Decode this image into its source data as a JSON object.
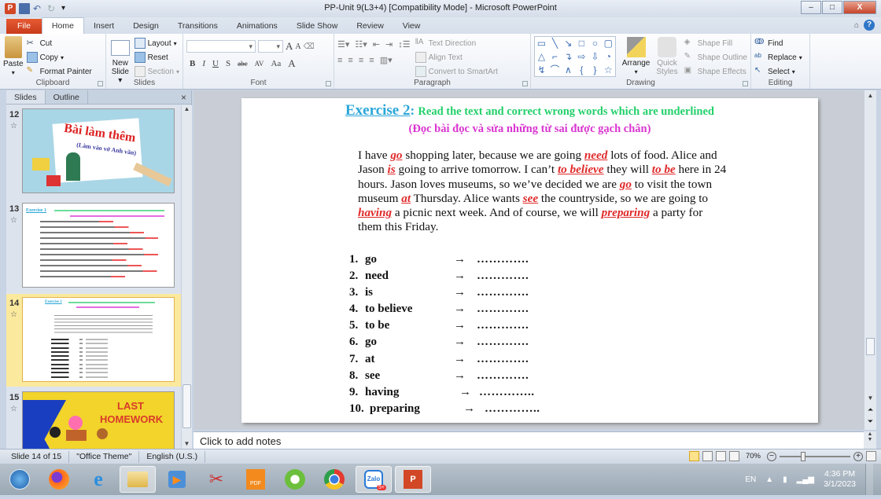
{
  "window": {
    "title": "PP-Unit 9(L3+4) [Compatibility Mode] - Microsoft PowerPoint",
    "controls": {
      "minimize": "–",
      "maximize": "□",
      "close": "X"
    }
  },
  "quick_access": {
    "app_icon": "P",
    "save": "save-icon",
    "undo": "undo-icon",
    "redo": "redo-icon",
    "customize": "▾"
  },
  "tabs": [
    {
      "label": "File"
    },
    {
      "label": "Home",
      "active": true
    },
    {
      "label": "Insert"
    },
    {
      "label": "Design"
    },
    {
      "label": "Transitions"
    },
    {
      "label": "Animations"
    },
    {
      "label": "Slide Show"
    },
    {
      "label": "Review"
    },
    {
      "label": "View"
    }
  ],
  "ribbon": {
    "clipboard": {
      "label": "Clipboard",
      "paste": "Paste",
      "cut": "Cut",
      "copy": "Copy",
      "format_painter": "Format Painter"
    },
    "slides": {
      "label": "Slides",
      "new_slide_1": "New",
      "new_slide_2": "Slide",
      "layout": "Layout",
      "reset": "Reset",
      "section": "Section"
    },
    "font": {
      "label": "Font",
      "font_name": "",
      "font_size": "",
      "bold": "B",
      "italic": "I",
      "underline": "U",
      "shadow": "S",
      "strike": "abc",
      "spacing": "AV",
      "case": "Aa",
      "color": "A",
      "grow": "A",
      "shrink": "A"
    },
    "paragraph": {
      "label": "Paragraph",
      "text_direction": "Text Direction",
      "align_text": "Align Text",
      "convert_smartart": "Convert to SmartArt"
    },
    "drawing": {
      "label": "Drawing",
      "arrange": "Arrange",
      "quick_styles_1": "Quick",
      "quick_styles_2": "Styles",
      "shape_fill": "Shape Fill",
      "shape_outline": "Shape Outline",
      "shape_effects": "Shape Effects",
      "shapes": [
        "▭",
        "╲",
        "↘",
        "□",
        "○",
        "▢",
        "△",
        "⌐",
        "↴",
        "⇨",
        "⇩",
        "◔",
        "↯",
        "⌒",
        "∧",
        "{",
        "}",
        "☆"
      ]
    },
    "editing": {
      "label": "Editing",
      "find": "Find",
      "replace": "Replace",
      "select": "Select"
    }
  },
  "left_pane": {
    "tabs": [
      {
        "label": "Slides",
        "active": true
      },
      {
        "label": "Outline"
      }
    ],
    "close": "×",
    "thumbnails": [
      {
        "number": "12",
        "title": "Bài làm thêm",
        "subtitle": "(Làm vào vở Anh văn)"
      },
      {
        "number": "13",
        "title": "Exercise 1"
      },
      {
        "number": "14",
        "title": "Exercise 2",
        "selected": true
      },
      {
        "number": "15",
        "title_line1": "LAST",
        "title_line2": "HOMEWORK"
      }
    ]
  },
  "slide": {
    "title_link": "Exercise 2",
    "title_sep": ": ",
    "instruction": "Read the text and correct wrong words which are underlined",
    "instruction_vi": "(Đọc bài đọc và sửa những từ sai được gạch chân)",
    "passage": [
      {
        "t": "I have "
      },
      {
        "e": "go"
      },
      {
        "t": " shopping later, because we are going "
      },
      {
        "e": "need"
      },
      {
        "t": " lots of food. Alice and Jason "
      },
      {
        "e": "is"
      },
      {
        "t": " going to arrive tomorrow. I can’t  "
      },
      {
        "e": "to believe"
      },
      {
        "t": " they will "
      },
      {
        "e": "to be"
      },
      {
        "t": " here in 24 hours. Jason loves museums, so we’ve decided we are "
      },
      {
        "e": "go"
      },
      {
        "t": "  to visit the town museum "
      },
      {
        "e": "at"
      },
      {
        "t": " Thursday. Alice wants "
      },
      {
        "e": "see"
      },
      {
        "t": " the countryside, so we are going to "
      },
      {
        "e": "having"
      },
      {
        "t": " a picnic next week. And of course, we will "
      },
      {
        "e": "preparing"
      },
      {
        "t": "  a party for them this Friday."
      }
    ],
    "answers": [
      {
        "num": "1.",
        "word": "go",
        "arrow": "→",
        "blank": "…………."
      },
      {
        "num": "2.",
        "word": "need",
        "arrow": "→",
        "blank": "…………."
      },
      {
        "num": "3.",
        "word": "is",
        "arrow": "→",
        "blank": "…………."
      },
      {
        "num": "4.",
        "word": "to believe",
        "arrow": "→",
        "blank": "…………."
      },
      {
        "num": "5.",
        "word": "to be",
        "arrow": "→",
        "blank": "…………."
      },
      {
        "num": "6.",
        "word": "go",
        "arrow": "→",
        "blank": "…………."
      },
      {
        "num": "7.",
        "word": "at",
        "arrow": "→",
        "blank": "…………."
      },
      {
        "num": "8.",
        "word": "see",
        "arrow": "→",
        "blank": "…………."
      },
      {
        "num": "9.",
        "word": "having",
        "arrow": "→",
        "blank": "………….."
      },
      {
        "num": "10.",
        "word": "preparing",
        "arrow": "→",
        "blank": "………….."
      }
    ]
  },
  "notes": {
    "placeholder": "Click to add notes"
  },
  "status": {
    "slide": "Slide 14 of 15",
    "theme": "\"Office Theme\"",
    "language": "English (U.S.)",
    "zoom": "70%",
    "zoom_level_percent": 70
  },
  "taskbar": {
    "apps": [
      "start-button",
      "firefox",
      "internet-explorer",
      "file-explorer",
      "media-player",
      "snipping-tool",
      "foxit-pdf",
      "coc-coc",
      "chrome",
      "zalo",
      "powerpoint"
    ],
    "zalo_badge": "5+",
    "tray": {
      "language": "EN",
      "time": "4:36 PM",
      "date": "3/1/2023"
    }
  }
}
